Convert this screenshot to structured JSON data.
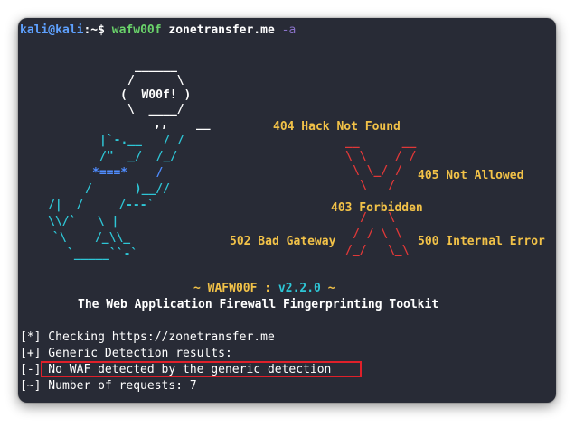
{
  "prompt": {
    "user": "kali@kali",
    "path": ":~$ ",
    "command": "wafw00f",
    "argument": " zonetransfer.me ",
    "flag": "-a"
  },
  "logo": {
    "hex_top": "______",
    "hex_l2": "/      \\",
    "hex_l3": "(  W00f! )",
    "hex_l4": "\\  ____/",
    "body_l1": ",,    __",
    "body_l2": "|`-.__   / /",
    "body_l3": "/\"  _/  /_/",
    "body_l4": "*===*    /",
    "body_l5": "/      )__//",
    "body_l6": "/|  /     /---`",
    "body_l7": "\\\\/`   \\ |",
    "body_l8": "`\\    /_\\\\_",
    "body_l9": "`_____``-`"
  },
  "errors": {
    "e404_hack": "404 Hack Not Found",
    "e405": "405 Not Allowed",
    "e403": "403 Forbidden",
    "e502": "502 Bad Gateway",
    "e500": "500 Internal Error"
  },
  "x_art": {
    "l1": "__      __",
    "l2": "\\ \\    / /",
    "l3": "\\ \\_/ /",
    "l4": "\\   /",
    "l5": "/   \\",
    "l6": "/ / \\ \\",
    "l7": "/_/   \\_\\"
  },
  "banner": {
    "prefix": "~ WAFW00F : ",
    "version": "v2.2.0",
    "suffix": " ~",
    "subtitle": "The Web Application Firewall Fingerprinting Toolkit"
  },
  "output": [
    {
      "tag": "[*]",
      "text": " Checking https://zonetransfer.me"
    },
    {
      "tag": "[+]",
      "text": " Generic Detection results:"
    },
    {
      "tag": "[-]",
      "text": " No WAF detected by the generic detection"
    },
    {
      "tag": "[~]",
      "text": " Number of requests: 7"
    }
  ],
  "colors": {
    "background": "#282b36",
    "highlight_box": "#e0202a",
    "error_text": "#f2c248",
    "x_mark": "#e03838",
    "logo_cyan": "#2ec6d6",
    "logo_green": "#8ad43a"
  }
}
